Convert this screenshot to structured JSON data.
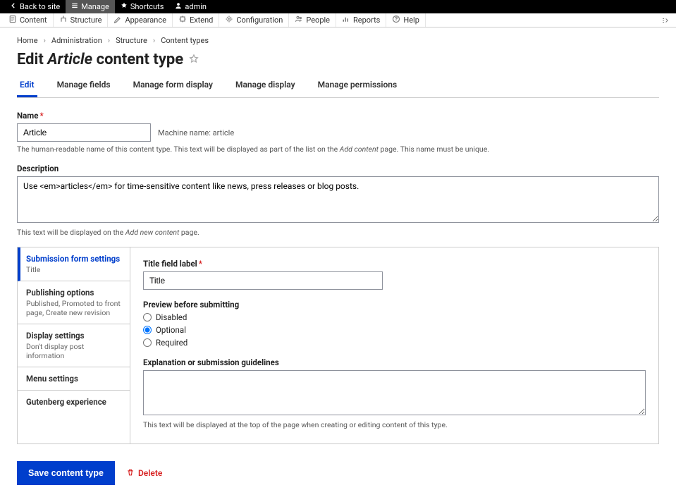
{
  "topbar": {
    "back": "Back to site",
    "manage": "Manage",
    "shortcuts": "Shortcuts",
    "admin": "admin"
  },
  "adminmenu": {
    "content": "Content",
    "structure": "Structure",
    "appearance": "Appearance",
    "extend": "Extend",
    "configuration": "Configuration",
    "people": "People",
    "reports": "Reports",
    "help": "Help"
  },
  "breadcrumb": {
    "home": "Home",
    "administration": "Administration",
    "structure": "Structure",
    "content_types": "Content types"
  },
  "page_title": {
    "prefix": "Edit ",
    "em": "Article",
    "suffix": " content type"
  },
  "tabs": {
    "edit": "Edit",
    "manage_fields": "Manage fields",
    "manage_form_display": "Manage form display",
    "manage_display": "Manage display",
    "manage_permissions": "Manage permissions"
  },
  "name_field": {
    "label": "Name",
    "value": "Article",
    "machine_label": "Machine name: ",
    "machine_value": "article",
    "help_a": "The human-readable name of this content type. This text will be displayed as part of the list on the ",
    "help_em": "Add content",
    "help_b": " page. This name must be unique."
  },
  "description_field": {
    "label": "Description",
    "value": "Use <em>articles</em> for time-sensitive content like news, press releases or blog posts.",
    "help_a": "This text will be displayed on the ",
    "help_em": "Add new content",
    "help_b": " page."
  },
  "vt": {
    "submission": {
      "title": "Submission form settings",
      "summary": "Title"
    },
    "publishing": {
      "title": "Publishing options",
      "summary": "Published, Promoted to front page, Create new revision"
    },
    "display": {
      "title": "Display settings",
      "summary": "Don't display post information"
    },
    "menu": {
      "title": "Menu settings"
    },
    "gutenberg": {
      "title": "Gutenberg experience"
    }
  },
  "submission_panel": {
    "title_label": "Title field label",
    "title_value": "Title",
    "preview_label": "Preview before submitting",
    "preview_disabled": "Disabled",
    "preview_optional": "Optional",
    "preview_required": "Required",
    "explanation_label": "Explanation or submission guidelines",
    "explanation_value": "",
    "explanation_help": "This text will be displayed at the top of the page when creating or editing content of this type."
  },
  "actions": {
    "save": "Save content type",
    "delete": "Delete"
  }
}
